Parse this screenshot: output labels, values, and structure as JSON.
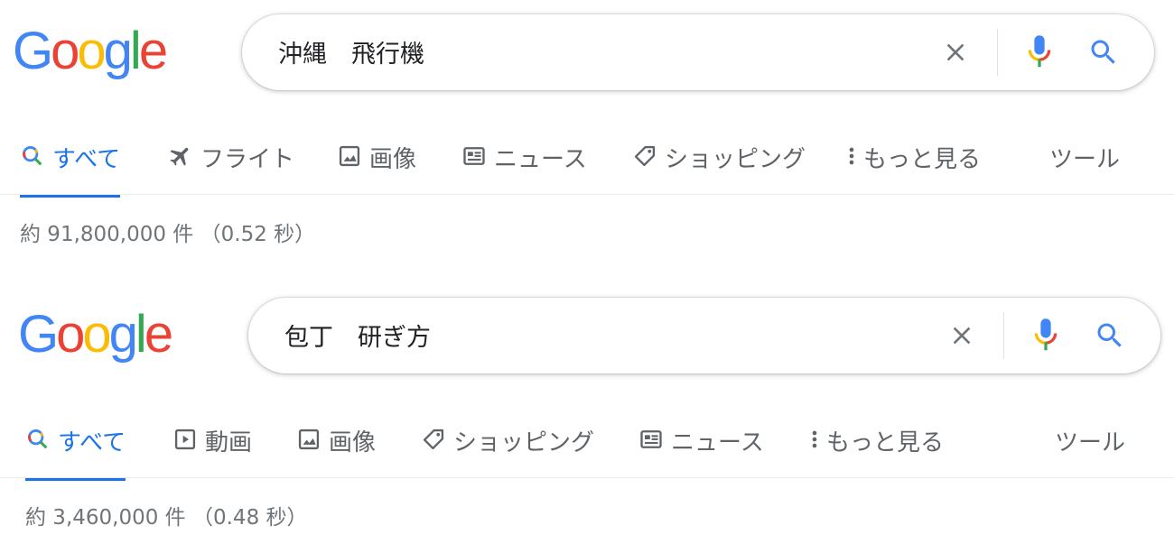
{
  "colors": {
    "google_blue": "#4285F4",
    "google_red": "#EA4335",
    "google_yellow": "#FBBC05",
    "google_green": "#34A853",
    "active_tab": "#1a73e8",
    "muted_text": "#5f6368"
  },
  "panels": [
    {
      "logo": {
        "g1": "G",
        "o1": "o",
        "o2": "o",
        "g2": "g",
        "l": "l",
        "e": "e"
      },
      "search": {
        "query": "沖縄　飛行機",
        "clear_icon": "close-icon",
        "mic_icon": "mic-icon",
        "search_icon": "search-icon"
      },
      "tabs": [
        {
          "label": "すべて",
          "icon": "search-icon",
          "active": true
        },
        {
          "label": "フライト",
          "icon": "airplane-icon",
          "active": false
        },
        {
          "label": "画像",
          "icon": "image-icon",
          "active": false
        },
        {
          "label": "ニュース",
          "icon": "news-icon",
          "active": false
        },
        {
          "label": "ショッピング",
          "icon": "tag-icon",
          "active": false
        },
        {
          "label": "もっと見る",
          "icon": "more-vert-icon",
          "active": false
        },
        {
          "label": "ツール",
          "icon": "",
          "active": false
        }
      ],
      "stats": "約 91,800,000 件 （0.52 秒）"
    },
    {
      "logo": {
        "g1": "G",
        "o1": "o",
        "o2": "o",
        "g2": "g",
        "l": "l",
        "e": "e"
      },
      "search": {
        "query": "包丁　研ぎ方",
        "clear_icon": "close-icon",
        "mic_icon": "mic-icon",
        "search_icon": "search-icon"
      },
      "tabs": [
        {
          "label": "すべて",
          "icon": "search-icon",
          "active": true
        },
        {
          "label": "動画",
          "icon": "video-icon",
          "active": false
        },
        {
          "label": "画像",
          "icon": "image-icon",
          "active": false
        },
        {
          "label": "ショッピング",
          "icon": "tag-icon",
          "active": false
        },
        {
          "label": "ニュース",
          "icon": "news-icon",
          "active": false
        },
        {
          "label": "もっと見る",
          "icon": "more-vert-icon",
          "active": false
        },
        {
          "label": "ツール",
          "icon": "",
          "active": false
        }
      ],
      "stats": "約 3,460,000 件 （0.48 秒）"
    }
  ]
}
